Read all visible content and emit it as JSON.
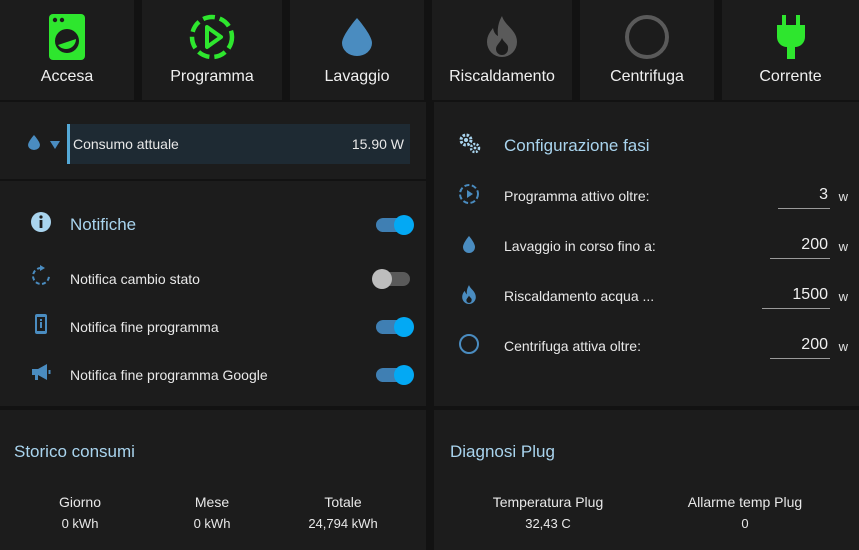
{
  "tiles": [
    {
      "label": "Accesa",
      "icon": "washing-machine-icon",
      "color": "#2ee62e"
    },
    {
      "label": "Programma",
      "icon": "play-circle-dashed-icon",
      "color": "#2ee62e"
    },
    {
      "label": "Lavaggio",
      "icon": "water-drop-icon",
      "color": "#4a8cc0"
    },
    {
      "label": "Riscaldamento",
      "icon": "fire-icon",
      "color": "#5a5a5a"
    },
    {
      "label": "Centrifuga",
      "icon": "circle-outline-icon",
      "color": "#5a5a5a"
    },
    {
      "label": "Corrente",
      "icon": "power-plug-icon",
      "color": "#2ee62e"
    }
  ],
  "consumo": {
    "label": "Consumo attuale",
    "value": "15.90 W"
  },
  "notifiche": {
    "title": "Notifiche",
    "items": [
      {
        "label": "Notifica cambio stato",
        "on": false
      },
      {
        "label": "Notifica fine programma",
        "on": true
      },
      {
        "label": "Notifica fine programma Google",
        "on": true
      }
    ]
  },
  "config": {
    "title": "Configurazione fasi",
    "rows": [
      {
        "label": "Programma attivo oltre:",
        "value": "3",
        "unit": "w"
      },
      {
        "label": "Lavaggio in corso fino a:",
        "value": "200",
        "unit": "w"
      },
      {
        "label": "Riscaldamento acqua ...",
        "value": "1500",
        "unit": "w"
      },
      {
        "label": "Centrifuga attiva oltre:",
        "value": "200",
        "unit": "w"
      }
    ]
  },
  "storico": {
    "title": "Storico consumi",
    "stats": [
      {
        "label": "Giorno",
        "value": "0 kWh"
      },
      {
        "label": "Mese",
        "value": "0 kWh"
      },
      {
        "label": "Totale",
        "value": "24,794 kWh"
      }
    ]
  },
  "diagnosi": {
    "title": "Diagnosi Plug",
    "stats": [
      {
        "label": "Temperatura Plug",
        "value": "32,43 C"
      },
      {
        "label": "Allarme temp Plug",
        "value": "0"
      }
    ]
  },
  "colors": {
    "accent": "#03a9f4",
    "title": "#a9d4ee",
    "icon_blue": "#4a8cc0",
    "on_green": "#2ee62e"
  }
}
